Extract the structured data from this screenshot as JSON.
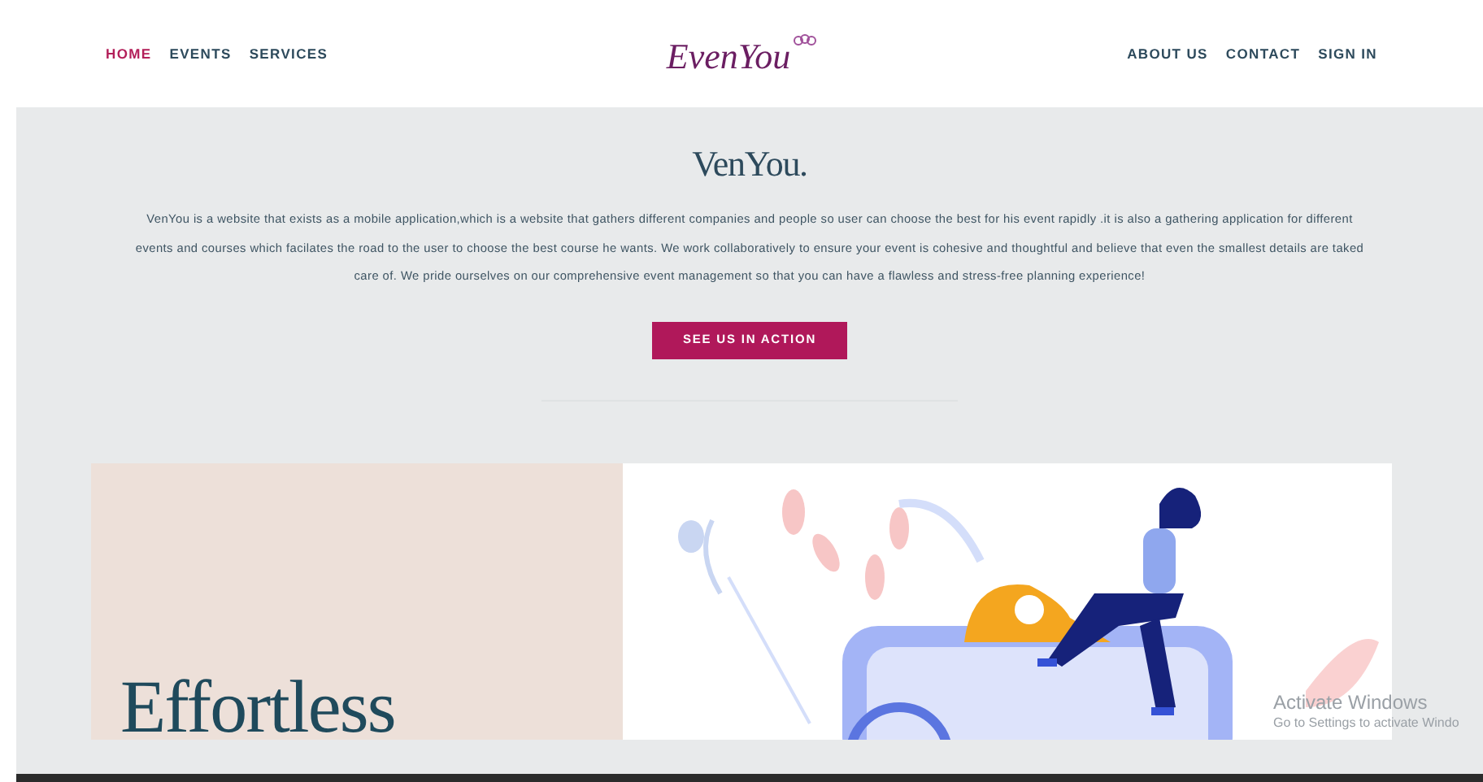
{
  "nav": {
    "left": [
      {
        "label": "HOME",
        "selected": true
      },
      {
        "label": "EVENTS",
        "selected": false
      },
      {
        "label": "SERVICES",
        "selected": false
      }
    ],
    "logo": "EvenYou",
    "right": [
      {
        "label": "ABOUT US",
        "selected": false
      },
      {
        "label": "CONTACT",
        "selected": false
      },
      {
        "label": "SIGN IN",
        "selected": false
      }
    ]
  },
  "intro": {
    "title": "VenYou.",
    "text": "VenYou is a website that exists as a mobile application,which is a website that gathers different companies and people so user can choose the best for his event rapidly .it is also a gathering application for different events and courses which facilates the road to the user to choose the best course he wants. We work collaboratively to ensure your event is cohesive and thoughtful and believe that even the smallest details are taked care of. We pride ourselves on our comprehensive event management so that you can have a flawless and stress-free planning experience!",
    "button": "SEE US IN ACTION"
  },
  "feature": {
    "heading": "Effortless"
  },
  "activation_notice": {
    "title": "Activate Windows",
    "text": "Go to Settings to activate Windo"
  }
}
